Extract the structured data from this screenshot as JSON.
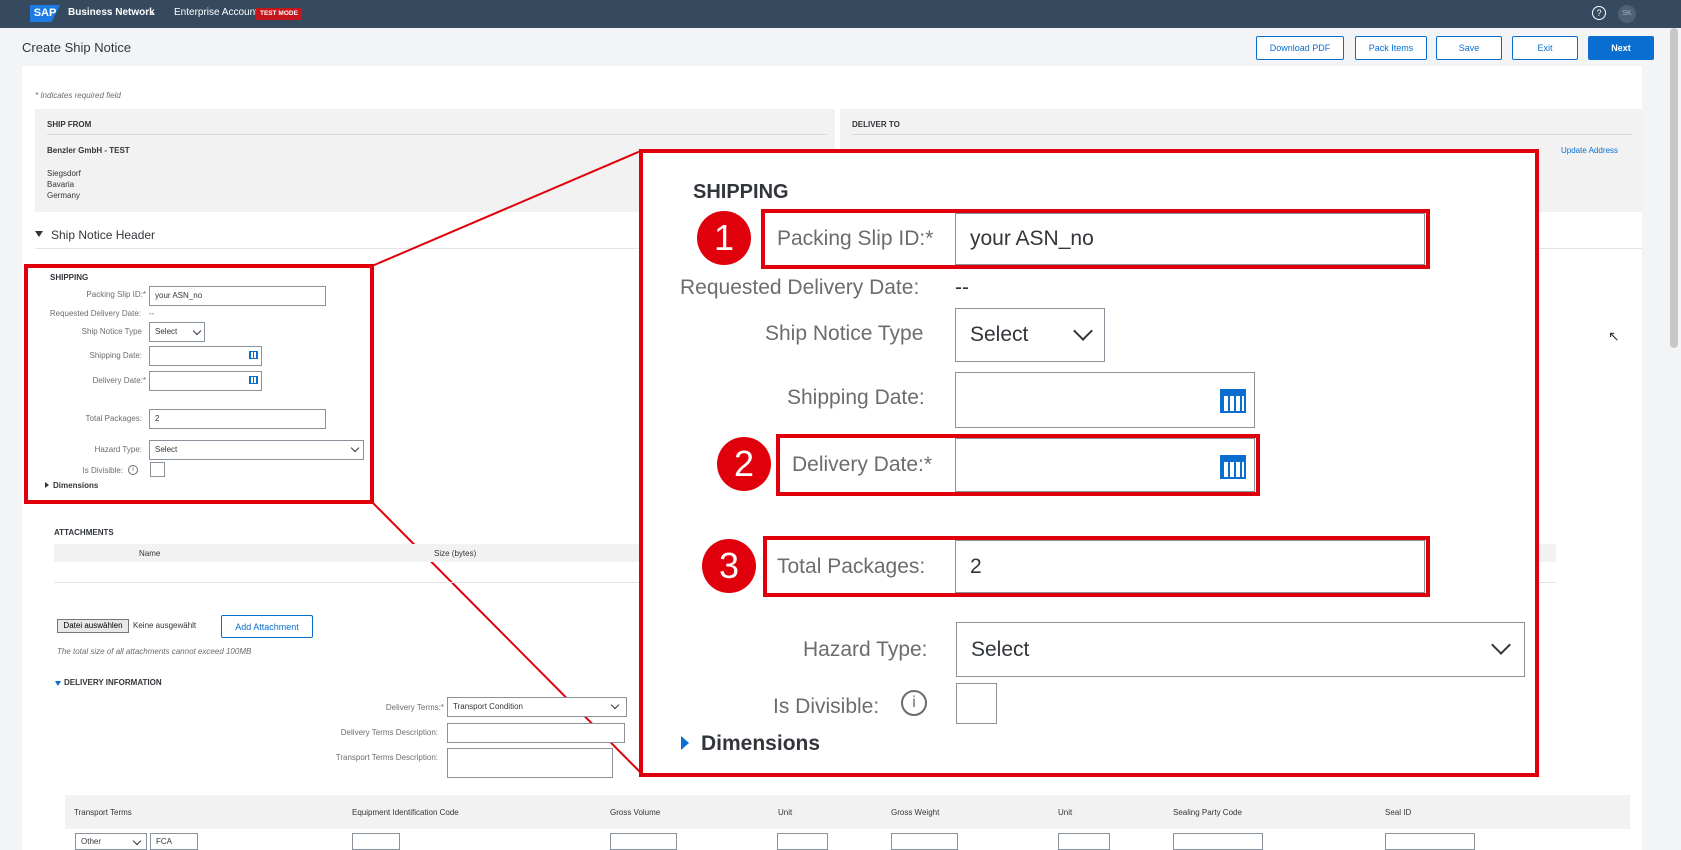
{
  "topbar": {
    "logo": "SAP",
    "network": "Business Network",
    "network_caret": "⌄",
    "account": "Enterprise Account",
    "test_mode": "TEST MODE",
    "help": "?",
    "avatar": "SK"
  },
  "header": {
    "title": "Create Ship Notice",
    "buttons": {
      "download_pdf": "Download PDF",
      "pack_items": "Pack Items",
      "save": "Save",
      "exit": "Exit",
      "next": "Next"
    }
  },
  "form": {
    "required_note": "* Indicates required field",
    "ship_from": {
      "title": "SHIP FROM",
      "company": "Benzler GmbH - TEST",
      "city": "Siegsdorf",
      "region": "Bavaria",
      "country": "Germany"
    },
    "deliver_to": {
      "title": "DELIVER TO",
      "update_address": "Update Address"
    },
    "section_header": "Ship Notice Header",
    "shipping": {
      "title": "SHIPPING",
      "packing_slip_label": "Packing Slip ID:*",
      "packing_slip_value": "your ASN_no",
      "requested_delivery_label": "Requested Delivery Date:",
      "requested_delivery_value": "--",
      "ship_notice_type_label": "Ship Notice Type",
      "ship_notice_type_value": "Select",
      "shipping_date_label": "Shipping Date:",
      "delivery_date_label": "Delivery Date:*",
      "total_packages_label": "Total Packages:",
      "total_packages_value": "2",
      "hazard_type_label": "Hazard Type:",
      "hazard_type_value": "Select",
      "is_divisible_label": "Is Divisible:",
      "info": "i",
      "dimensions": "Dimensions"
    },
    "attachments": {
      "title": "ATTACHMENTS",
      "col_name": "Name",
      "col_size": "Size (bytes)",
      "choose_file": "Datei auswählen",
      "no_file": "Keine ausgewählt",
      "add_attachment": "Add Attachment",
      "note": "The total size of all attachments cannot exceed 100MB"
    },
    "delivery_info": {
      "title": "DELIVERY INFORMATION",
      "terms_label": "Delivery Terms:*",
      "terms_value": "Transport Condition",
      "terms_desc_label": "Delivery Terms Description:",
      "transport_desc_label": "Transport Terms Description:"
    },
    "transport_table": {
      "columns": [
        "Transport Terms",
        "Equipment Identification Code",
        "Gross Volume",
        "Unit",
        "Gross Weight",
        "Unit",
        "Sealing Party Code",
        "Seal ID"
      ],
      "row": {
        "terms": "Other",
        "code": "FCA"
      }
    }
  },
  "callouts": {
    "one": "1",
    "two": "2",
    "three": "3"
  },
  "cursor": "↖"
}
